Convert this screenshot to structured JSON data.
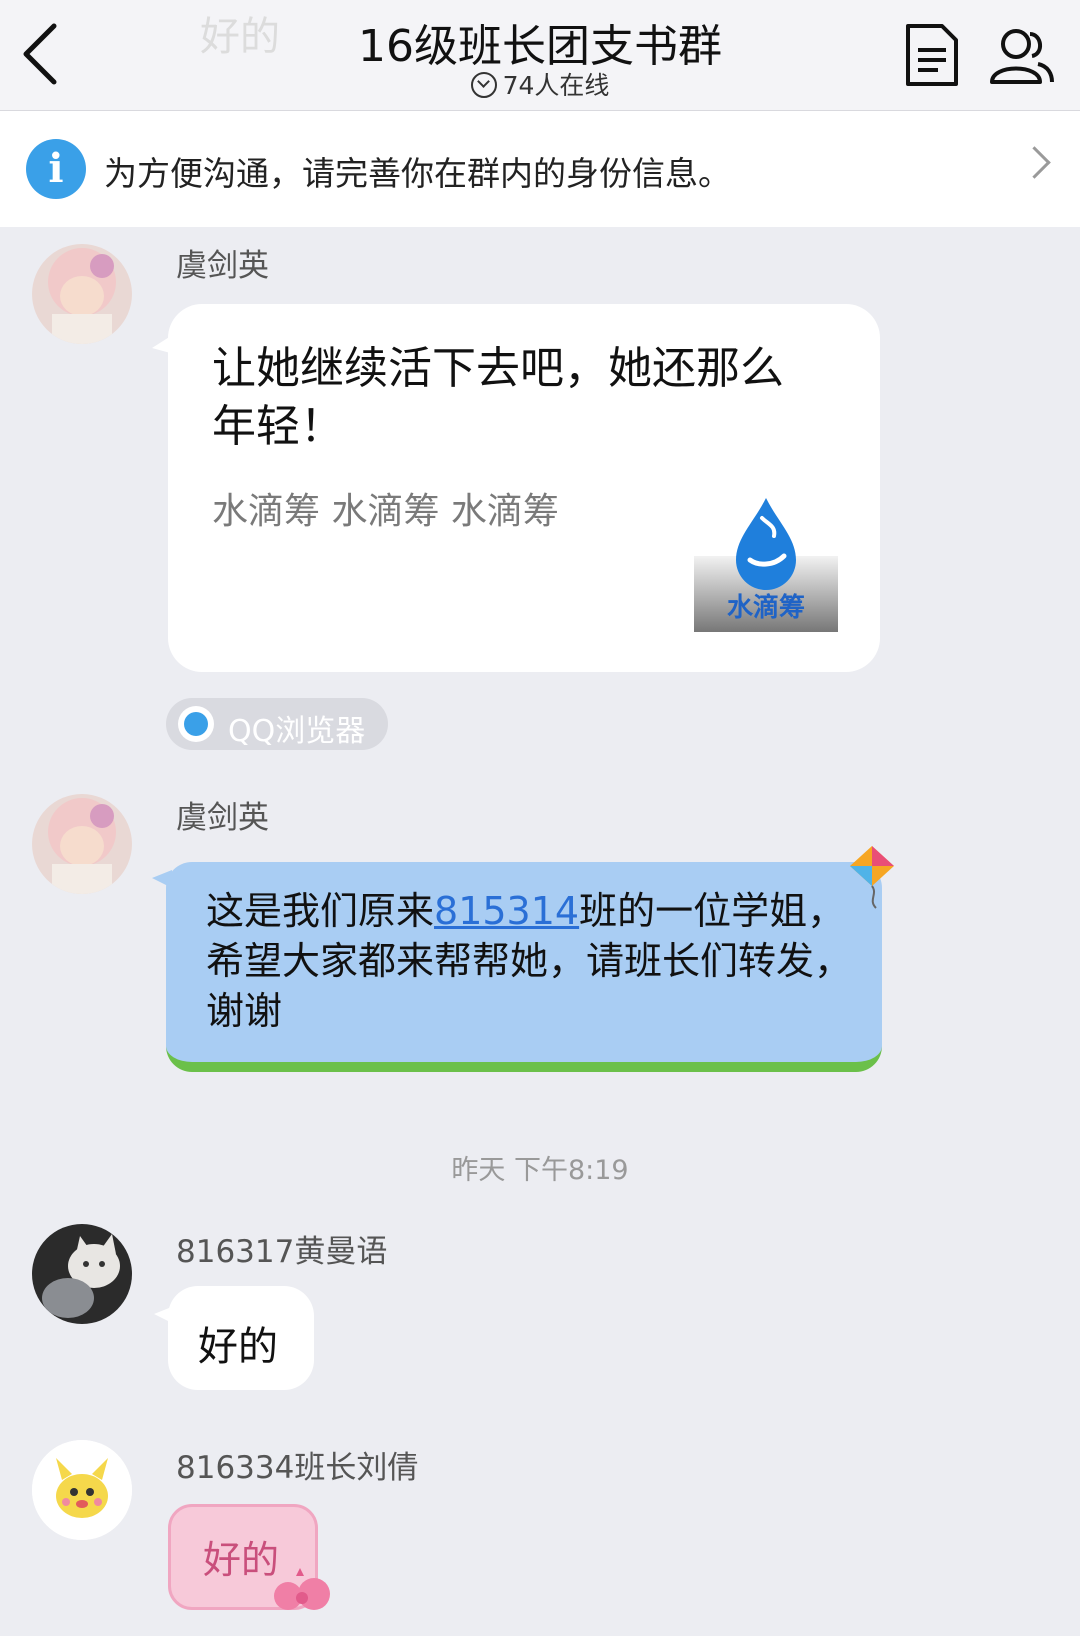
{
  "header": {
    "ghost_text": "好的",
    "title": "16级班长团支书群",
    "online_status": "74人在线"
  },
  "notice": {
    "text": "为方便沟通，请完善你在群内的身份信息。"
  },
  "messages": [
    {
      "sender": "虞剑英",
      "card": {
        "title": "让她继续活下去吧，她还那么年轻！",
        "subtitle": "水滴筹 水滴筹 水滴筹",
        "logo_text": "水滴筹"
      },
      "source": "QQ浏览器"
    },
    {
      "sender": "虞剑英",
      "text_before_link": "这是我们原来",
      "link": "815314",
      "text_after_link": "班的一位学姐，希望大家都来帮帮她，请班长们转发，谢谢"
    }
  ],
  "timestamp": "昨天 下午8:19",
  "replies": [
    {
      "sender": "816317黄曼语",
      "text": "好的"
    },
    {
      "sender": "816334班长刘倩",
      "text": "好的"
    }
  ],
  "colors": {
    "background": "#ecedf2",
    "blue_bubble": "#a9cdf3",
    "link": "#2a6fd6",
    "accent": "#3aa0e8",
    "pink_bubble": "#f7c9d9"
  }
}
